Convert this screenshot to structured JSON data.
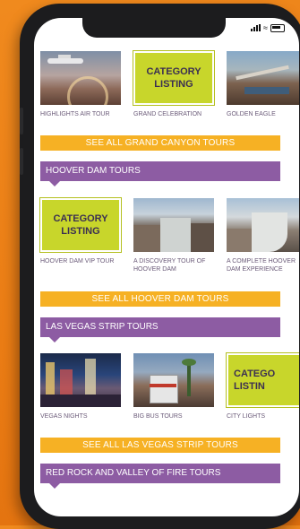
{
  "status": {
    "icons": [
      "signal-icon",
      "wifi-icon",
      "battery-icon"
    ]
  },
  "sections": {
    "grand_canyon": {
      "tiles": [
        {
          "caption": "HIGHLIGHTS AIR TOUR"
        },
        {
          "label_line1": "CATEGORY",
          "label_line2": "LISTING",
          "caption": "GRAND CELEBRATION"
        },
        {
          "caption": "GOLDEN EAGLE"
        }
      ],
      "see_all": "SEE ALL GRAND CANYON TOURS"
    },
    "hoover_dam": {
      "title": "HOOVER DAM TOURS",
      "tiles": [
        {
          "label_line1": "CATEGORY",
          "label_line2": "LISTING",
          "caption": "HOOVER DAM VIP TOUR"
        },
        {
          "caption": "A DISCOVERY TOUR OF HOOVER DAM"
        },
        {
          "caption": "A COMPLETE HOOVER DAM EXPERIENCE"
        }
      ],
      "see_all": "SEE ALL HOOVER DAM TOURS"
    },
    "las_vegas": {
      "title": "LAS VEGAS STRIP TOURS",
      "tiles": [
        {
          "caption": "VEGAS NIGHTS"
        },
        {
          "caption": "BIG BUS TOURS"
        },
        {
          "label_line1": "CATEGO",
          "label_line2": "LISTIN",
          "caption": "CITY LIGHTS"
        }
      ],
      "see_all": "SEE ALL LAS VEGAS STRIP TOURS"
    },
    "red_rock": {
      "title": "RED ROCK AND VALLEY OF FIRE TOURS"
    }
  },
  "colors": {
    "purple": "#8d5ca3",
    "orange_button": "#f6b124",
    "category_green": "#c8d62b",
    "background": "#ea7c14"
  }
}
